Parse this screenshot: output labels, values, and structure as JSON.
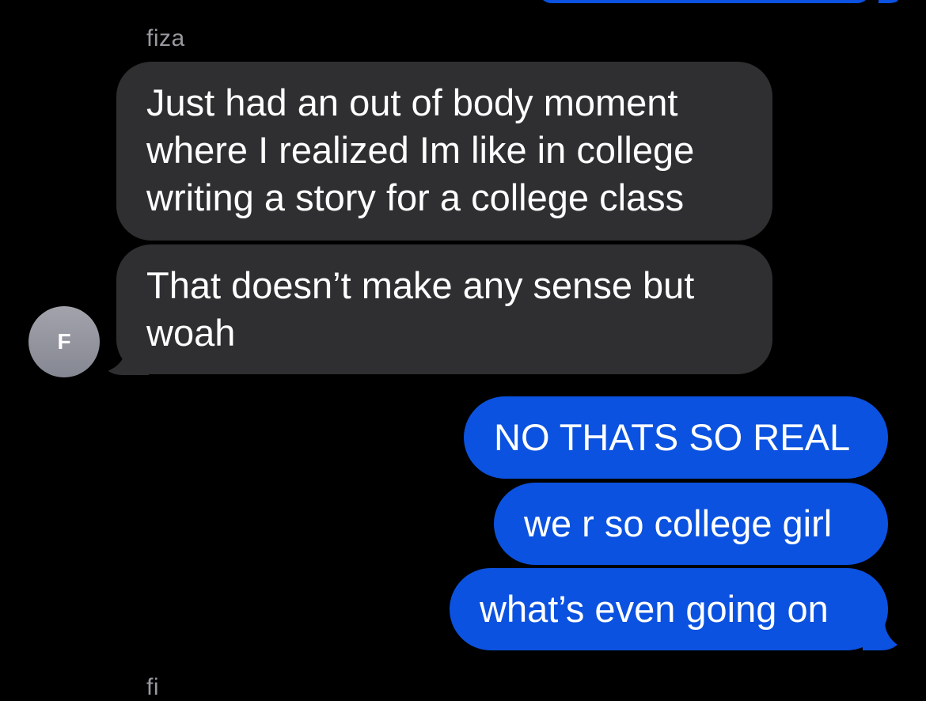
{
  "conversation": {
    "sender_name": "fiza",
    "sender_name_cut": "fi",
    "avatar_initial": "F",
    "incoming": [
      {
        "lines": [
          "Just had an out of body moment",
          "where I realized Im like in college",
          "writing a story for a college class"
        ]
      },
      {
        "lines": [
          "That doesn’t make any sense but",
          "woah"
        ]
      }
    ],
    "outgoing": [
      {
        "text": "NO THATS SO REAL"
      },
      {
        "text": "we r so college girl"
      },
      {
        "text": "what’s even going on"
      }
    ]
  },
  "colors": {
    "background": "#000000",
    "incoming_bubble": "#2f2f31",
    "outgoing_bubble": "#0b52e0",
    "sender_name": "#98989f",
    "avatar": "#8f9099"
  }
}
